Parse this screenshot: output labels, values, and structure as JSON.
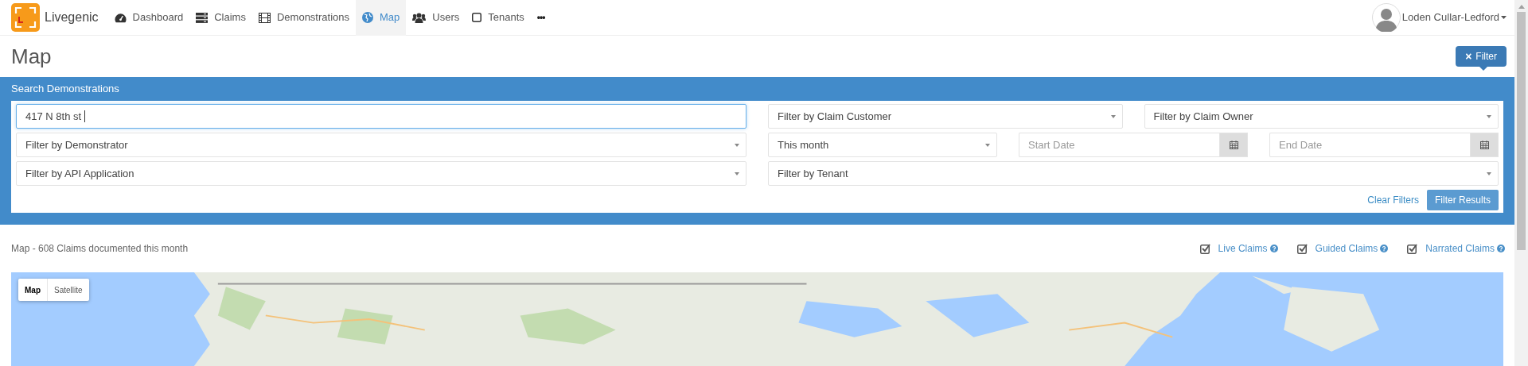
{
  "brand": {
    "name": "Livegenic"
  },
  "nav": [
    {
      "label": "Dashboard",
      "kind": "gauge",
      "selected": false
    },
    {
      "label": "Claims",
      "kind": "server",
      "selected": false
    },
    {
      "label": "Demonstrations",
      "kind": "film",
      "selected": false
    },
    {
      "label": "Map",
      "kind": "globe",
      "selected": true
    },
    {
      "label": "Users",
      "kind": "users",
      "selected": false
    },
    {
      "label": "Tenants",
      "kind": "square",
      "selected": false
    }
  ],
  "nav_more": "•••",
  "user": {
    "name": "Loden Cullar-Ledford"
  },
  "page_title": "Map",
  "filter_button": {
    "icon": "×",
    "label": "Filter"
  },
  "search_panel": {
    "title": "Search Demonstrations",
    "address": {
      "value": "417 N 8th st "
    },
    "demonstrator": "Filter by Demonstrator",
    "api_application": "Filter by API Application",
    "claim_customer": "Filter by Claim Customer",
    "claim_owner": "Filter by Claim Owner",
    "period": "This month",
    "start_date": {
      "placeholder": "Start Date"
    },
    "end_date": {
      "placeholder": "End Date"
    },
    "tenant": "Filter by Tenant",
    "clear_link": "Clear Filters",
    "submit_button": "Filter Results"
  },
  "map_caption": "Map - 608 Claims documented this month",
  "claim_types": [
    {
      "label": "Live Claims",
      "checked": true
    },
    {
      "label": "Guided Claims",
      "checked": true
    },
    {
      "label": "Narrated Claims",
      "checked": true
    }
  ],
  "map_types": [
    {
      "label": "Map",
      "selected": true
    },
    {
      "label": "Satellite",
      "selected": false
    }
  ]
}
